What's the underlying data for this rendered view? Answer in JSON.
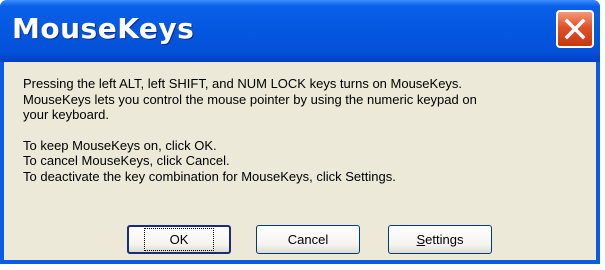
{
  "window": {
    "title": "MouseKeys"
  },
  "message": {
    "lines_para1": [
      "Pressing the left ALT, left SHIFT, and NUM LOCK keys turns on MouseKeys.",
      "MouseKeys lets you control the mouse pointer by using the numeric keypad on",
      "your keyboard."
    ],
    "lines_para2": [
      "To keep MouseKeys on, click OK.",
      "To cancel MouseKeys, click Cancel.",
      "To deactivate the key combination for MouseKeys, click Settings."
    ]
  },
  "buttons": {
    "ok_label": "OK",
    "cancel_label": "Cancel",
    "settings_label_first": "S",
    "settings_label_rest": "ettings"
  },
  "icons": {
    "close": "close-icon"
  },
  "colors": {
    "titlebar": "#0458e0",
    "close": "#e0512a",
    "body": "#ece9d8"
  }
}
